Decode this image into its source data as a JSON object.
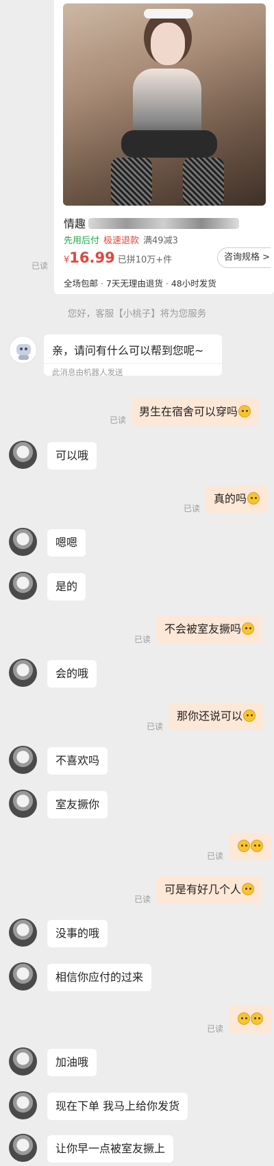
{
  "product": {
    "title": "情趣",
    "tags": {
      "green": "先用后付",
      "red": "极速退款",
      "promo": "满49减3"
    },
    "price_symbol": "¥",
    "price": "16.99",
    "sold": "已拼10万+件",
    "consult_label": "咨询规格 >",
    "services": [
      "全场包邮",
      "7天无理由退货",
      "48小时发货"
    ]
  },
  "read_label": "已读",
  "system_notice": "您好，客服【小桃子】将为您服务",
  "robot_message": {
    "text": "亲，请问有什么可以帮到您呢~",
    "note": "此消息由机器人发送"
  },
  "messages": [
    {
      "side": "right",
      "text": "男生在宿舍可以穿吗",
      "emoji": [
        "flushed-face"
      ]
    },
    {
      "side": "left",
      "text": "可以哦"
    },
    {
      "side": "right",
      "text": "真的吗",
      "emoji": [
        "smirk-face"
      ]
    },
    {
      "side": "left",
      "text": "嗯嗯"
    },
    {
      "side": "left",
      "text": "是的"
    },
    {
      "side": "right",
      "text": "不会被室友撅吗",
      "emoji": [
        "smirk-face"
      ]
    },
    {
      "side": "left",
      "text": "会的哦"
    },
    {
      "side": "right",
      "text": "那你还说可以",
      "emoji": [
        "frown-face"
      ]
    },
    {
      "side": "left",
      "text": "不喜欢吗"
    },
    {
      "side": "left",
      "text": "室友撅你"
    },
    {
      "side": "right",
      "text": "",
      "emoji": [
        "flushed-face",
        "flushed-face"
      ]
    },
    {
      "side": "right",
      "text": "可是有好几个人",
      "emoji": [
        "flushed-face"
      ]
    },
    {
      "side": "left",
      "text": "没事的哦"
    },
    {
      "side": "left",
      "text": "相信你应付的过来"
    },
    {
      "side": "right",
      "text": "",
      "emoji": [
        "flushed-face",
        "flushed-face"
      ]
    },
    {
      "side": "left",
      "text": "加油哦"
    },
    {
      "side": "left",
      "text": "现在下单  我马上给你发货"
    },
    {
      "side": "left",
      "text": "让你早一点被室友撅上"
    }
  ]
}
